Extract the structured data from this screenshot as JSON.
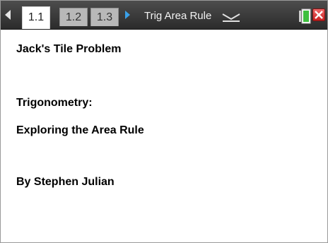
{
  "tabbar": {
    "tabs": [
      {
        "label": "1.1",
        "active": true
      },
      {
        "label": "1.2",
        "active": false
      },
      {
        "label": "1.3",
        "active": false
      }
    ],
    "document_title": "Trig Area Rule",
    "icons": {
      "prev": "left-arrow-icon",
      "next": "right-arrow-icon",
      "menu": "dropdown-icon",
      "status": "battery-icon",
      "close": "close-icon"
    },
    "colors": {
      "tabbar_bg": "#3a3a3a",
      "next_arrow": "#3aa0e8",
      "close_red": "#d62828",
      "battery_green": "#3fbf3f"
    }
  },
  "document": {
    "title": "Jack's Tile Problem",
    "subject": "Trigonometry:",
    "subtitle": "Exploring the Area Rule",
    "author": "By Stephen Julian"
  }
}
